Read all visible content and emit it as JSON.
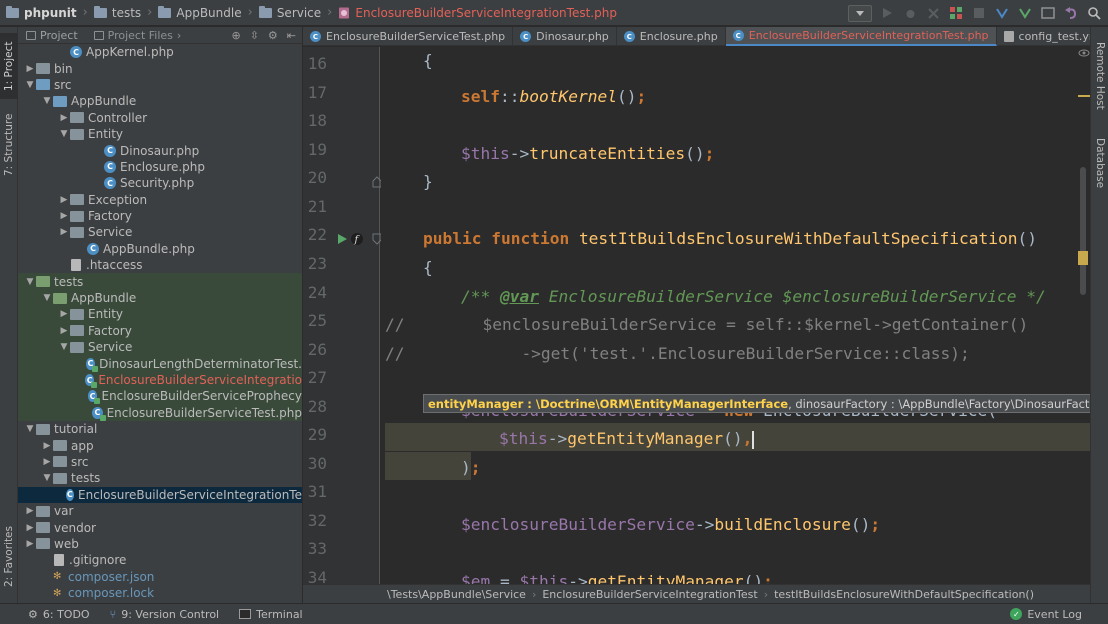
{
  "nav": {
    "crumbs": [
      "phpunit",
      "tests",
      "AppBundle",
      "Service",
      "EnclosureBuilderServiceIntegrationTest.php"
    ]
  },
  "left_strip": {
    "project": "1: Project",
    "structure": "7: Structure",
    "favorites": "2: Favorites"
  },
  "right_strip": {
    "remote": "Remote Host",
    "database": "Database"
  },
  "project_panel": {
    "tab_project": "Project",
    "tab_files": "Project Files",
    "tree": [
      {
        "label": "AppKernel.php",
        "indent": 3,
        "icon": "class",
        "arrow": ""
      },
      {
        "label": "bin",
        "indent": 1,
        "icon": "folder",
        "arrow": "right"
      },
      {
        "label": "src",
        "indent": 1,
        "icon": "folder-blue",
        "arrow": "down"
      },
      {
        "label": "AppBundle",
        "indent": 2,
        "icon": "folder-blue",
        "arrow": "down"
      },
      {
        "label": "Controller",
        "indent": 3,
        "icon": "folder",
        "arrow": "right"
      },
      {
        "label": "Entity",
        "indent": 3,
        "icon": "folder",
        "arrow": "down"
      },
      {
        "label": "Dinosaur.php",
        "indent": 5,
        "icon": "class",
        "arrow": ""
      },
      {
        "label": "Enclosure.php",
        "indent": 5,
        "icon": "class",
        "arrow": ""
      },
      {
        "label": "Security.php",
        "indent": 5,
        "icon": "class",
        "arrow": ""
      },
      {
        "label": "Exception",
        "indent": 3,
        "icon": "folder",
        "arrow": "right"
      },
      {
        "label": "Factory",
        "indent": 3,
        "icon": "folder",
        "arrow": "right"
      },
      {
        "label": "Service",
        "indent": 3,
        "icon": "folder",
        "arrow": "right"
      },
      {
        "label": "AppBundle.php",
        "indent": 4,
        "icon": "class",
        "arrow": ""
      },
      {
        "label": ".htaccess",
        "indent": 3,
        "icon": "file",
        "arrow": ""
      },
      {
        "label": "tests",
        "indent": 1,
        "icon": "folder-green",
        "arrow": "down",
        "green": true
      },
      {
        "label": "AppBundle",
        "indent": 2,
        "icon": "folder-green",
        "arrow": "down",
        "green": true
      },
      {
        "label": "Entity",
        "indent": 3,
        "icon": "folder",
        "arrow": "right",
        "green": true
      },
      {
        "label": "Factory",
        "indent": 3,
        "icon": "folder",
        "arrow": "right",
        "green": true
      },
      {
        "label": "Service",
        "indent": 3,
        "icon": "folder",
        "arrow": "down",
        "green": true
      },
      {
        "label": "DinosaurLengthDeterminatorTest.",
        "indent": 5,
        "icon": "test",
        "arrow": "",
        "green": true
      },
      {
        "label": "EnclosureBuilderServiceIntegratio",
        "indent": 5,
        "icon": "test",
        "arrow": "",
        "green": true,
        "red": true
      },
      {
        "label": "EnclosureBuilderServiceProphecy",
        "indent": 5,
        "icon": "test",
        "arrow": "",
        "green": true
      },
      {
        "label": "EnclosureBuilderServiceTest.php",
        "indent": 5,
        "icon": "test",
        "arrow": "",
        "green": true
      },
      {
        "label": "tutorial",
        "indent": 1,
        "icon": "folder",
        "arrow": "down"
      },
      {
        "label": "app",
        "indent": 2,
        "icon": "folder",
        "arrow": "right"
      },
      {
        "label": "src",
        "indent": 2,
        "icon": "folder",
        "arrow": "right"
      },
      {
        "label": "tests",
        "indent": 2,
        "icon": "folder",
        "arrow": "down"
      },
      {
        "label": "EnclosureBuilderServiceIntegrationTe",
        "indent": 4,
        "icon": "class",
        "arrow": "",
        "selected": true
      },
      {
        "label": "var",
        "indent": 1,
        "icon": "folder",
        "arrow": "right"
      },
      {
        "label": "vendor",
        "indent": 1,
        "icon": "folder",
        "arrow": "right"
      },
      {
        "label": "web",
        "indent": 1,
        "icon": "folder",
        "arrow": "right"
      },
      {
        "label": ".gitignore",
        "indent": 2,
        "icon": "file",
        "arrow": ""
      },
      {
        "label": "composer.json",
        "indent": 2,
        "icon": "json",
        "arrow": "",
        "blue": true
      },
      {
        "label": "composer.lock",
        "indent": 2,
        "icon": "json",
        "arrow": "",
        "blue": true
      }
    ]
  },
  "tabs": [
    {
      "label": "EnclosureBuilderServiceTest.php",
      "icon": "class"
    },
    {
      "label": "Dinosaur.php",
      "icon": "class"
    },
    {
      "label": "Enclosure.php",
      "icon": "class"
    },
    {
      "label": "EnclosureBuilderServiceIntegrationTest.php",
      "icon": "class",
      "active": true
    },
    {
      "label": "config_test.yml",
      "icon": "yml"
    }
  ],
  "line_numbers": [
    "16",
    "17",
    "18",
    "19",
    "20",
    "21",
    "22",
    "23",
    "24",
    "25",
    "26",
    "27",
    "28",
    "29",
    "30",
    "31",
    "32",
    "33",
    "34"
  ],
  "tooltip": {
    "bold": "entityManager : \\Doctrine\\ORM\\EntityManagerInterface",
    "rest": ", dinosaurFactory : \\AppBundle\\Factory\\DinosaurFactory"
  },
  "editor_crumbs": [
    "\\Tests\\AppBundle\\Service",
    "EnclosureBuilderServiceIntegrationTest",
    "testItBuildsEnclosureWithDefaultSpecification()"
  ],
  "status": {
    "todo": "6: TODO",
    "vcs": "9: Version Control",
    "terminal": "Terminal",
    "event_log": "Event Log"
  },
  "colors": {
    "keyword": "#cc7832",
    "function": "#ffc66d",
    "variable": "#9876aa",
    "comment": "#629755",
    "current_file": "#e26158"
  }
}
